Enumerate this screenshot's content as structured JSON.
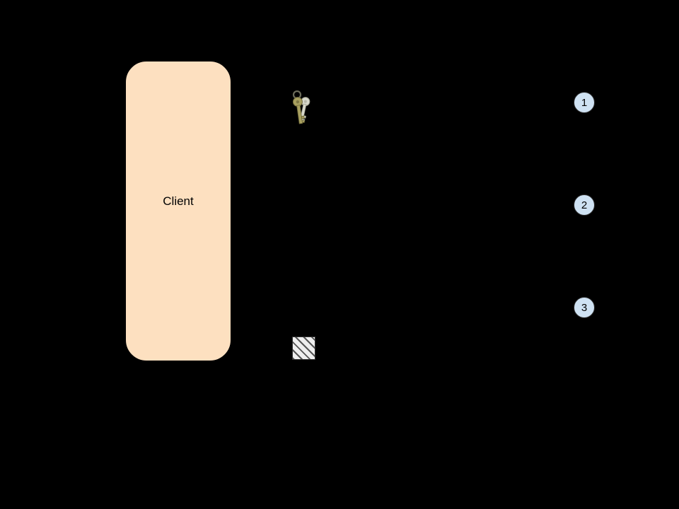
{
  "client": {
    "label": "Client"
  },
  "steps": [
    {
      "num": "1"
    },
    {
      "num": "2"
    },
    {
      "num": "3"
    }
  ],
  "icons": {
    "keys": "keys-icon",
    "hatched": "hatched-box"
  }
}
